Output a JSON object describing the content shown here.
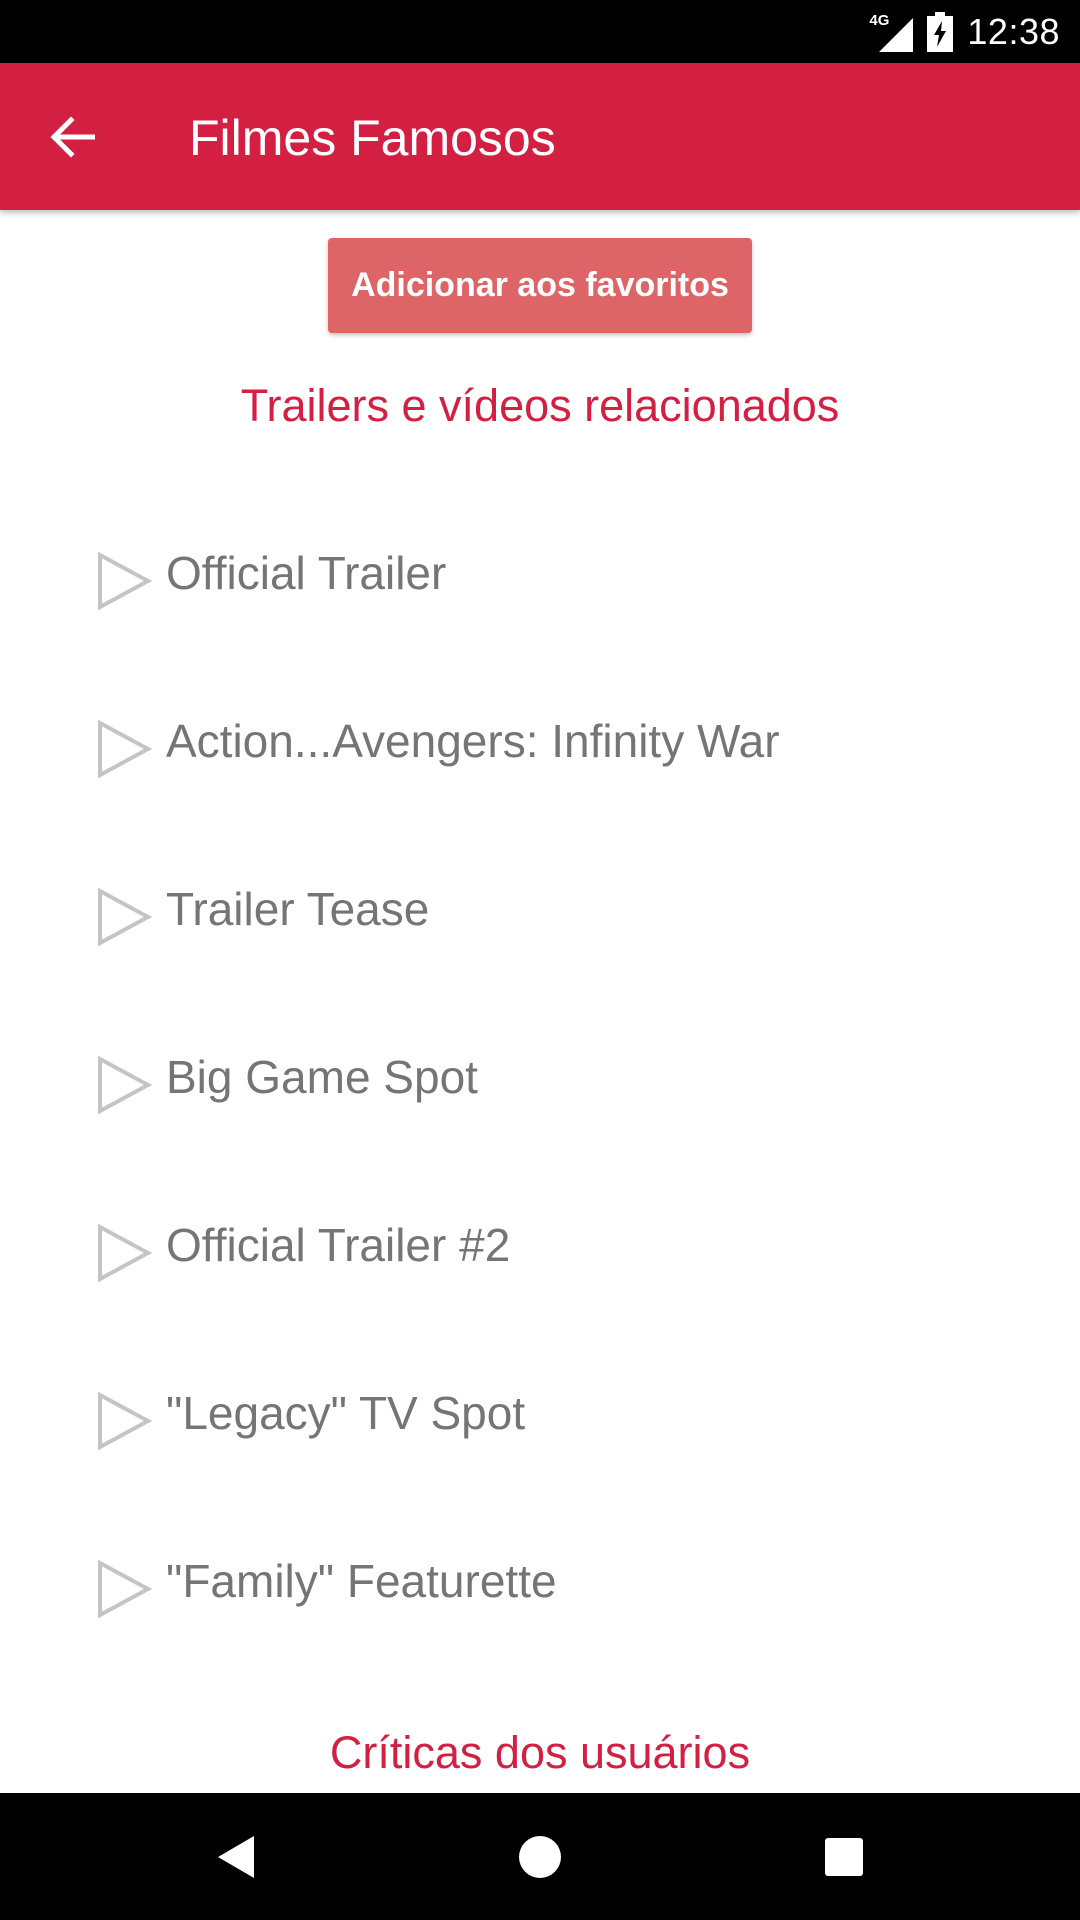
{
  "status_bar": {
    "network_type": "4G",
    "time": "12:38",
    "icons": [
      "signal-icon",
      "battery-charging-icon"
    ]
  },
  "app_bar": {
    "title": "Filmes Famosos",
    "back_icon": "arrow-back-icon"
  },
  "actions": {
    "favorite_label": "Adicionar aos favoritos"
  },
  "sections": {
    "trailers_title": "Trailers e vídeos relacionados",
    "reviews_title": "Críticas dos usuários"
  },
  "trailers": [
    {
      "label": "Official Trailer"
    },
    {
      "label": "Action...Avengers: Infinity War"
    },
    {
      "label": "Trailer Tease"
    },
    {
      "label": "Big Game Spot"
    },
    {
      "label": "Official Trailer #2"
    },
    {
      "label": "\"Legacy\" TV Spot"
    },
    {
      "label": "\"Family\" Featurette"
    }
  ],
  "nav_bar": {
    "icons": [
      "nav-back-icon",
      "nav-home-icon",
      "nav-recents-icon"
    ]
  },
  "colors": {
    "primary": "#d32042",
    "button": "#de6567",
    "item_text": "#757575",
    "play_icon": "#c4c4c4",
    "status_bar": "#000000",
    "nav_bar": "#000000"
  }
}
